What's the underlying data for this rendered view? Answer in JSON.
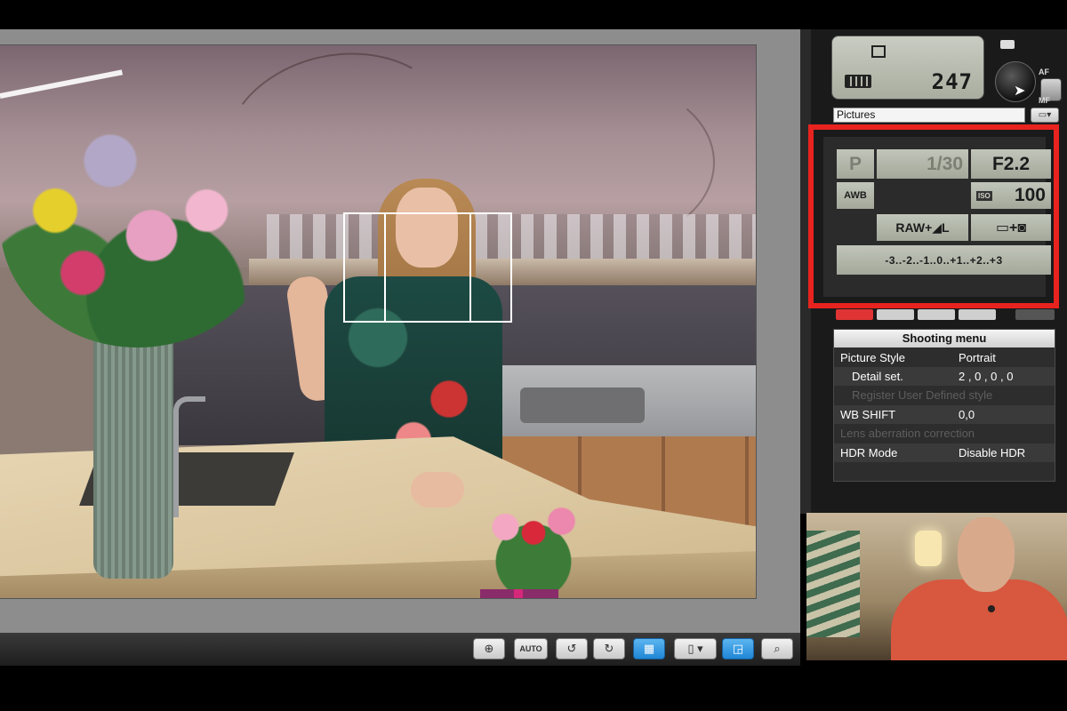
{
  "camera_status": {
    "shots_remaining": "247",
    "af_label": "AF",
    "mf_label": "MF",
    "folder": "Pictures"
  },
  "settings_lcd": {
    "mode": "P",
    "shutter": "1/30",
    "aperture": "F2.2",
    "white_balance": "AWB",
    "iso_label": "ISO",
    "iso": "100",
    "quality": "RAW+◢L",
    "exposure_scale": "-3..-2..-1..0..+1..+2..+3"
  },
  "shooting_menu": {
    "title": "Shooting menu",
    "rows": [
      {
        "label": "Picture Style",
        "value": "Portrait",
        "enabled": true
      },
      {
        "label": "Detail set.",
        "value": "2 , 0 , 0 , 0",
        "enabled": true
      },
      {
        "label": "Register User Defined style",
        "value": "",
        "enabled": false
      },
      {
        "label": "WB SHIFT",
        "value": "0,0",
        "enabled": true
      },
      {
        "label": "Lens aberration correction",
        "value": "",
        "enabled": false
      },
      {
        "label": "HDR Mode",
        "value": "Disable HDR",
        "enabled": true
      }
    ]
  },
  "toolbar": {
    "auto_label": "AUTO",
    "icons": [
      "crosshair-icon",
      "auto-focus-icon",
      "rotate-left-icon",
      "rotate-right-icon",
      "grid-icon",
      "aspect-ratio-icon",
      "image-view-icon",
      "zoom-icon"
    ]
  },
  "colors": {
    "highlight": "#e8231f",
    "lcd": "#b4b8ab",
    "toolbar_active": "#1f86d6"
  }
}
